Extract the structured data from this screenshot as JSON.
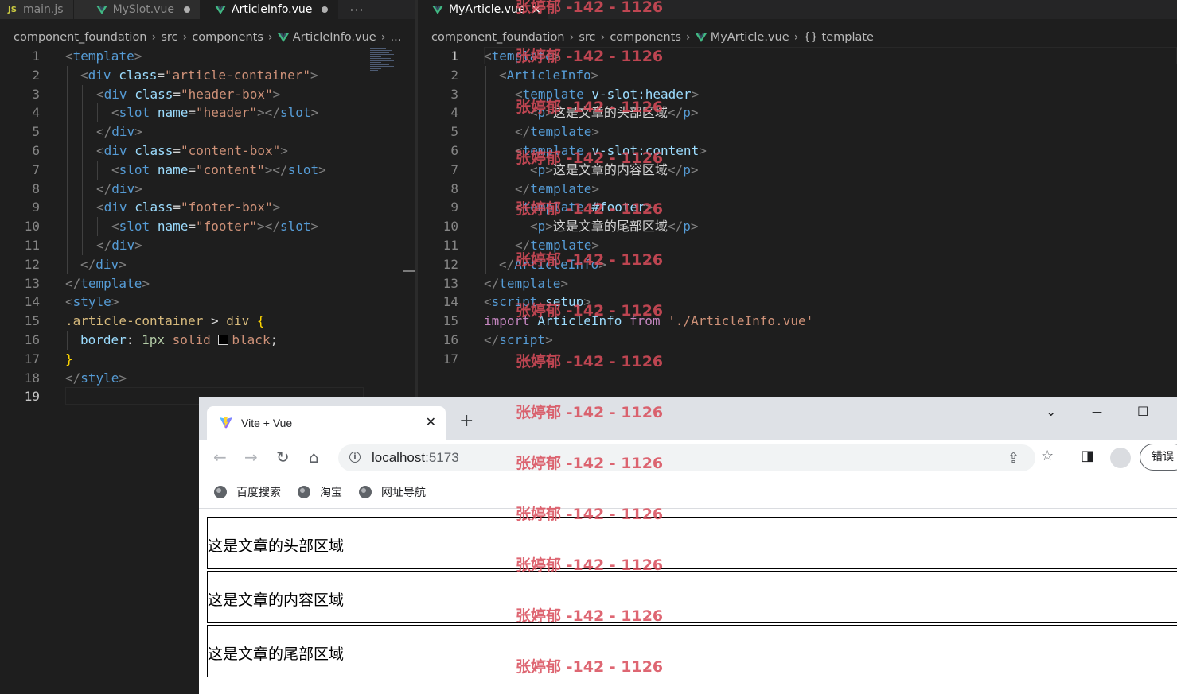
{
  "left_editor": {
    "tabs": [
      {
        "label": "main.js",
        "icon": "JS"
      },
      {
        "label": "MySlot.vue",
        "dirty": true
      },
      {
        "label": "ArticleInfo.vue",
        "dirty": true,
        "active": true
      }
    ],
    "more": "···",
    "breadcrumb": [
      "component_foundation",
      "src",
      "components",
      "ArticleInfo.vue",
      "..."
    ],
    "line_numbers": [
      "1",
      "2",
      "3",
      "4",
      "5",
      "6",
      "7",
      "8",
      "9",
      "10",
      "11",
      "12",
      "13",
      "14",
      "15",
      "16",
      "17",
      "18",
      "19"
    ],
    "code": {
      "l1": {
        "b1": "<",
        "tag": "template",
        "b2": ">"
      },
      "l2": {
        "b1": "<",
        "tag": "div",
        "attr": "class",
        "eq": "=",
        "str": "\"article-container\"",
        "b2": ">"
      },
      "l3": {
        "b1": "<",
        "tag": "div",
        "attr": "class",
        "eq": "=",
        "str": "\"header-box\"",
        "b2": ">"
      },
      "l4": {
        "b1": "<",
        "tag": "slot",
        "attr": "name",
        "eq": "=",
        "str": "\"header\"",
        "b2": "></",
        "tag2": "slot",
        "b3": ">"
      },
      "l5": {
        "b1": "</",
        "tag": "div",
        "b2": ">"
      },
      "l6": {
        "b1": "<",
        "tag": "div",
        "attr": "class",
        "eq": "=",
        "str": "\"content-box\"",
        "b2": ">"
      },
      "l7": {
        "b1": "<",
        "tag": "slot",
        "attr": "name",
        "eq": "=",
        "str": "\"content\"",
        "b2": "></",
        "tag2": "slot",
        "b3": ">"
      },
      "l8": {
        "b1": "</",
        "tag": "div",
        "b2": ">"
      },
      "l9": {
        "b1": "<",
        "tag": "div",
        "attr": "class",
        "eq": "=",
        "str": "\"footer-box\"",
        "b2": ">"
      },
      "l10": {
        "b1": "<",
        "tag": "slot",
        "attr": "name",
        "eq": "=",
        "str": "\"footer\"",
        "b2": "></",
        "tag2": "slot",
        "b3": ">"
      },
      "l11": {
        "b1": "</",
        "tag": "div",
        "b2": ">"
      },
      "l12": {
        "b1": "</",
        "tag": "div",
        "b2": ">"
      },
      "l13": {
        "b1": "</",
        "tag": "template",
        "b2": ">"
      },
      "l14": {
        "b1": "<",
        "tag": "style",
        "b2": ">"
      },
      "l15": {
        "sel": ".article-container",
        "comb": " > ",
        "tag": "div",
        "brace": " {"
      },
      "l16": {
        "prop": "border",
        "colon": ": ",
        "num": "1px",
        "val": " solid ",
        "color_word": "black",
        "semi": ";"
      },
      "l17": {
        "brace": "}"
      },
      "l18": {
        "b1": "</",
        "tag": "style",
        "b2": ">"
      }
    }
  },
  "right_editor": {
    "tab": {
      "label": "MyArticle.vue",
      "close": "✕"
    },
    "breadcrumb": [
      "component_foundation",
      "src",
      "components",
      "MyArticle.vue",
      "{} template"
    ],
    "line_numbers": [
      "1",
      "2",
      "3",
      "4",
      "5",
      "6",
      "7",
      "8",
      "9",
      "10",
      "11",
      "12",
      "13",
      "14",
      "15",
      "16",
      "17"
    ],
    "code": {
      "l1": {
        "b1": "<",
        "tag": "template",
        "b2": ">"
      },
      "l2": {
        "b1": "<",
        "tag": "ArticleInfo",
        "b2": ">"
      },
      "l3": {
        "b1": "<",
        "tag": "template",
        "dir": " v-slot:header",
        "b2": ">"
      },
      "l4": {
        "b1": "<",
        "tag": "p",
        "b2": ">",
        "text": "这是文章的头部区域",
        "b3": "</",
        "tag2": "p",
        "b4": ">"
      },
      "l5": {
        "b1": "</",
        "tag": "template",
        "b2": ">"
      },
      "l6": {
        "b1": "<",
        "tag": "template",
        "dir": " v-slot:content",
        "b2": ">"
      },
      "l7": {
        "b1": "<",
        "tag": "p",
        "b2": ">",
        "text": "这是文章的内容区域",
        "b3": "</",
        "tag2": "p",
        "b4": ">"
      },
      "l8": {
        "b1": "</",
        "tag": "template",
        "b2": ">"
      },
      "l9": {
        "b1": "<",
        "tag": "template",
        "dir": " #footer",
        "b2": ">"
      },
      "l10": {
        "b1": "<",
        "tag": "p",
        "b2": ">",
        "text": "这是文章的尾部区域",
        "b3": "</",
        "tag2": "p",
        "b4": ">"
      },
      "l11": {
        "b1": "</",
        "tag": "template",
        "b2": ">"
      },
      "l12": {
        "b1": "</",
        "tag": "ArticleInfo",
        "b2": ">"
      },
      "l13": {
        "b1": "</",
        "tag": "template",
        "b2": ">"
      },
      "l14": {
        "b1": "<",
        "tag": "script",
        "attr": " setup",
        "b2": ">"
      },
      "l15": {
        "kw": "import",
        "ident": " ArticleInfo ",
        "kw2": "from",
        "str": " './ArticleInfo.vue'"
      },
      "l16": {
        "b1": "</",
        "tag": "script",
        "b2": ">"
      }
    }
  },
  "browser": {
    "tab_title": "Vite + Vue",
    "tab_close": "✕",
    "new_tab": "+",
    "window_controls": {
      "dropdown": "⌄",
      "minimize": "—",
      "maximize": "☐"
    },
    "url_host": "localhost",
    "url_port": ":5173",
    "error_button": "错误",
    "bookmarks": [
      "百度搜索",
      "淘宝",
      "网址导航"
    ],
    "content": [
      "这是文章的头部区域",
      "这是文章的内容区域",
      "这是文章的尾部区域"
    ]
  },
  "watermark": "张婷郁 -142 - 1126",
  "colors": {
    "editor_bg": "#1e1e1e",
    "tag": "#569cd6",
    "attr": "#9cdcfe",
    "string": "#ce9178",
    "watermark": "#d94c5a"
  }
}
